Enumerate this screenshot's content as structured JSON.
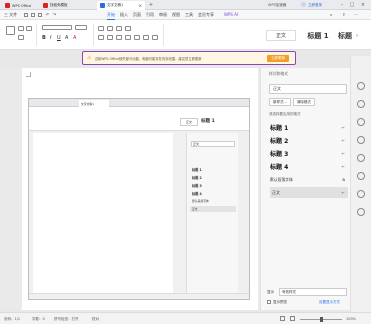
{
  "titlebar": {
    "tabs": [
      {
        "label": "WPS Office",
        "color": "#e02020"
      },
      {
        "label": "找稻壳模板",
        "color": "#e02020"
      },
      {
        "label": "文字文稿1",
        "color": "#2a6de0"
      }
    ],
    "right_badge": "WPS加速器",
    "login": "立即登录"
  },
  "menubar": {
    "file": "三 文件",
    "items": [
      "开始",
      "插入",
      "页面",
      "引用",
      "审阅",
      "视图",
      "工具",
      "会员专享"
    ],
    "selected": "开始",
    "extra": [
      "WPS AI"
    ]
  },
  "ribbon": {
    "styles": [
      "正文",
      "标题 1",
      "标题"
    ]
  },
  "notification": {
    "text": "当前WPS Office缺失部分功能，电脑可能存在内存泄露，建议您立即更新",
    "button": "立即更新"
  },
  "pane": {
    "title": "样式和格式",
    "current": "正文",
    "new_style": "新样式...",
    "clear_format": "清除格式",
    "section_title": "请选择要应用的格式",
    "styles": [
      "标题 1",
      "标题 2",
      "标题 3",
      "标题 4",
      "默认段落字体",
      "正文"
    ],
    "show_label": "显示",
    "show_value": "有效样式",
    "preview_label": "显示预览",
    "policy": "设置显示方式"
  },
  "inner": {
    "tabs": [
      "文字文稿1"
    ],
    "current": "正文",
    "styles": [
      "标题 1",
      "标题 2",
      "标题 3",
      "标题 4",
      "默认段落字体",
      "正文"
    ]
  },
  "statusbar": {
    "page": "页码：1/1",
    "words": "字数：0",
    "spell": "拼写检查：打开",
    "correct": "校对",
    "zoom": "100%"
  },
  "colors": {
    "accent": "#2a6de0",
    "highlight_border": "#8e45b8",
    "update_button": "#f29d2a"
  }
}
